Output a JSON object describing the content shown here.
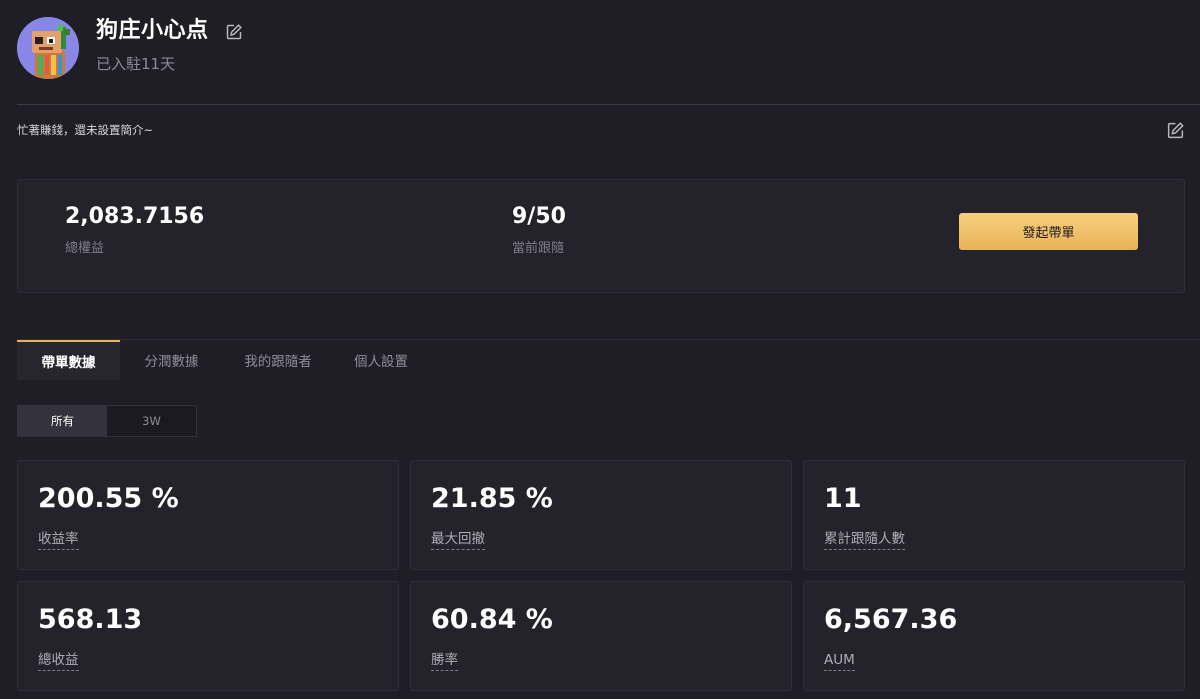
{
  "profile": {
    "username": "狗庄小心点",
    "joined": "已入駐11天",
    "bio": "忙著賺錢，還未設置簡介~"
  },
  "summary": {
    "total_equity_value": "2,083.7156",
    "total_equity_label": "總權益",
    "followers_value": "9/50",
    "followers_label": "當前跟隨",
    "start_button": "發起帶單"
  },
  "tabs": [
    {
      "label": "帶單數據",
      "active": true
    },
    {
      "label": "分潤數據",
      "active": false
    },
    {
      "label": "我的跟隨者",
      "active": false
    },
    {
      "label": "個人設置",
      "active": false
    }
  ],
  "range": [
    {
      "label": "所有",
      "active": true
    },
    {
      "label": "3W",
      "active": false
    }
  ],
  "stats": [
    {
      "value": "200.55 %",
      "label": "收益率"
    },
    {
      "value": "21.85 %",
      "label": "最大回撤"
    },
    {
      "value": "11",
      "label": "累計跟隨人數"
    },
    {
      "value": "568.13",
      "label": "總收益"
    },
    {
      "value": "60.84 %",
      "label": "勝率"
    },
    {
      "value": "6,567.36",
      "label": "AUM"
    }
  ],
  "colors": {
    "background": "#1f1e26",
    "card": "#24232c",
    "accent": "#e9b357",
    "avatar_bg": "#8a86e6"
  },
  "icons": {
    "name_edit": "edit-icon",
    "bio_edit": "edit-icon",
    "avatar": "robot-avatar"
  }
}
